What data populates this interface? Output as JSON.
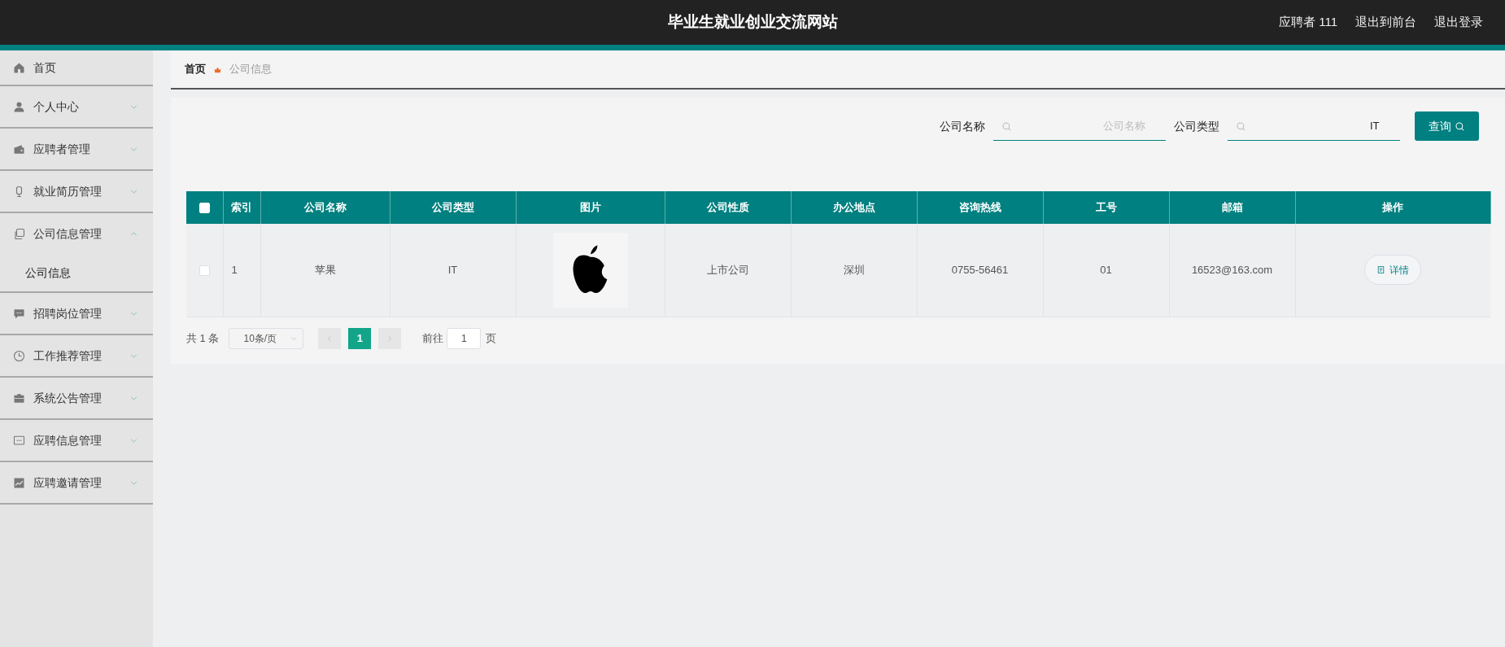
{
  "header": {
    "title": "毕业生就业创业交流网站",
    "links": [
      "应聘者 111",
      "退出到前台",
      "退出登录"
    ]
  },
  "sidebar": {
    "items": [
      {
        "label": "首页",
        "kind": "link"
      },
      {
        "label": "个人中心",
        "kind": "menu",
        "expanded": false
      },
      {
        "label": "应聘者管理",
        "kind": "menu",
        "expanded": false
      },
      {
        "label": "就业简历管理",
        "kind": "menu",
        "expanded": false
      },
      {
        "label": "公司信息管理",
        "kind": "menu",
        "expanded": true,
        "children": [
          {
            "label": "公司信息"
          }
        ]
      },
      {
        "label": "招聘岗位管理",
        "kind": "menu",
        "expanded": false
      },
      {
        "label": "工作推荐管理",
        "kind": "menu",
        "expanded": false
      },
      {
        "label": "系统公告管理",
        "kind": "menu",
        "expanded": false
      },
      {
        "label": "应聘信息管理",
        "kind": "menu",
        "expanded": false
      },
      {
        "label": "应聘邀请管理",
        "kind": "menu",
        "expanded": false
      }
    ]
  },
  "breadcrumb": [
    "首页",
    "公司信息"
  ],
  "search": {
    "fields": [
      {
        "label": "公司名称",
        "placeholder": "公司名称"
      },
      {
        "label": "公司类型",
        "value": "IT"
      }
    ],
    "button": "查询"
  },
  "table": {
    "columns": [
      "索引",
      "公司名称",
      "公司类型",
      "图片",
      "公司性质",
      "办公地点",
      "咨询热线",
      "工号",
      "邮箱",
      "操作"
    ],
    "header_checked": false,
    "rows": [
      {
        "checked": false,
        "cells": [
          "1",
          "苹果",
          "IT",
          null,
          "上市公司",
          "深圳",
          "0755-56461",
          "01",
          "16523@163.com"
        ],
        "action": "详情"
      }
    ]
  },
  "pagination": {
    "total": "共 1 条",
    "page_size": "10条/页",
    "pages": [
      {
        "label": "1",
        "selected": true
      }
    ],
    "goto_label": "前往",
    "goto_value": "1",
    "goto_suffix": "页"
  }
}
